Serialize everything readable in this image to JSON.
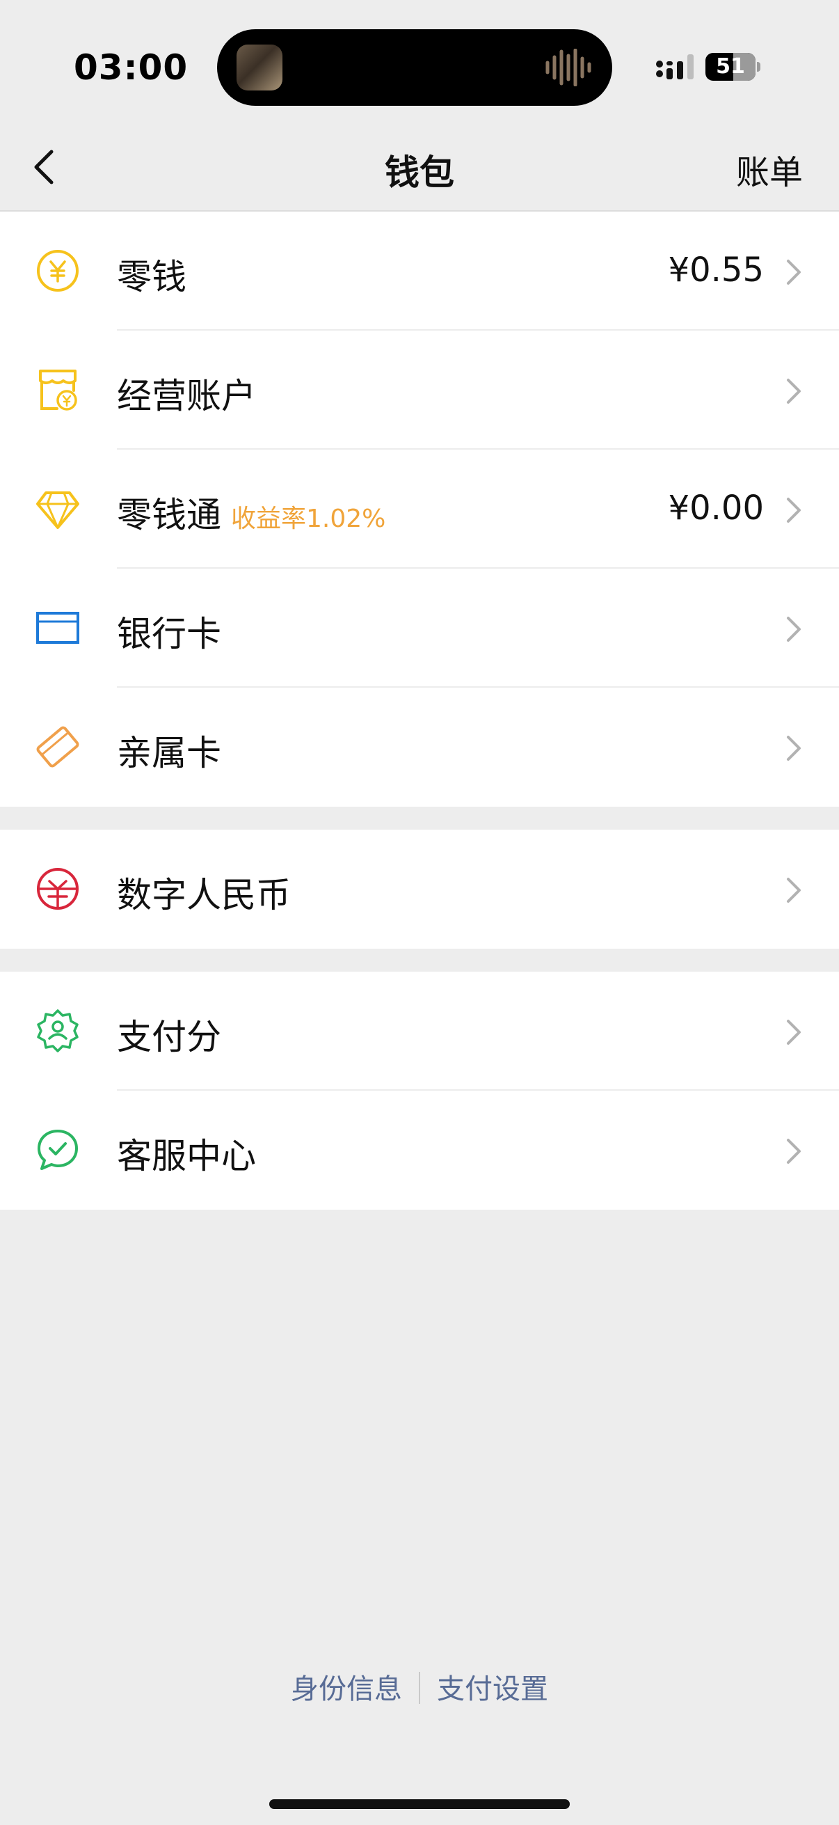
{
  "status_bar": {
    "time": "03:00",
    "battery_level": "51"
  },
  "nav": {
    "title": "钱包",
    "right_action": "账单"
  },
  "groups": [
    {
      "items": [
        {
          "label": "零钱",
          "value": "¥0.55",
          "icon": "yuan-coin-icon",
          "color": "#f6c21c"
        },
        {
          "label": "经营账户",
          "value": "",
          "icon": "shop-icon",
          "color": "#f6c21c"
        },
        {
          "label": "零钱通",
          "tag": "收益率1.02%",
          "value": "¥0.00",
          "icon": "diamond-icon",
          "color": "#f6c21c"
        },
        {
          "label": "银行卡",
          "value": "",
          "icon": "bank-card-icon",
          "color": "#1e7ad8"
        },
        {
          "label": "亲属卡",
          "value": "",
          "icon": "family-card-icon",
          "color": "#f0a04b"
        }
      ]
    },
    {
      "items": [
        {
          "label": "数字人民币",
          "value": "",
          "icon": "digital-rmb-icon",
          "color": "#d8263b"
        }
      ]
    },
    {
      "items": [
        {
          "label": "支付分",
          "value": "",
          "icon": "pay-score-icon",
          "color": "#2bb562"
        },
        {
          "label": "客服中心",
          "value": "",
          "icon": "customer-service-icon",
          "color": "#2bb562"
        }
      ]
    }
  ],
  "footer": {
    "identity_link": "身份信息",
    "pay_settings_link": "支付设置"
  }
}
